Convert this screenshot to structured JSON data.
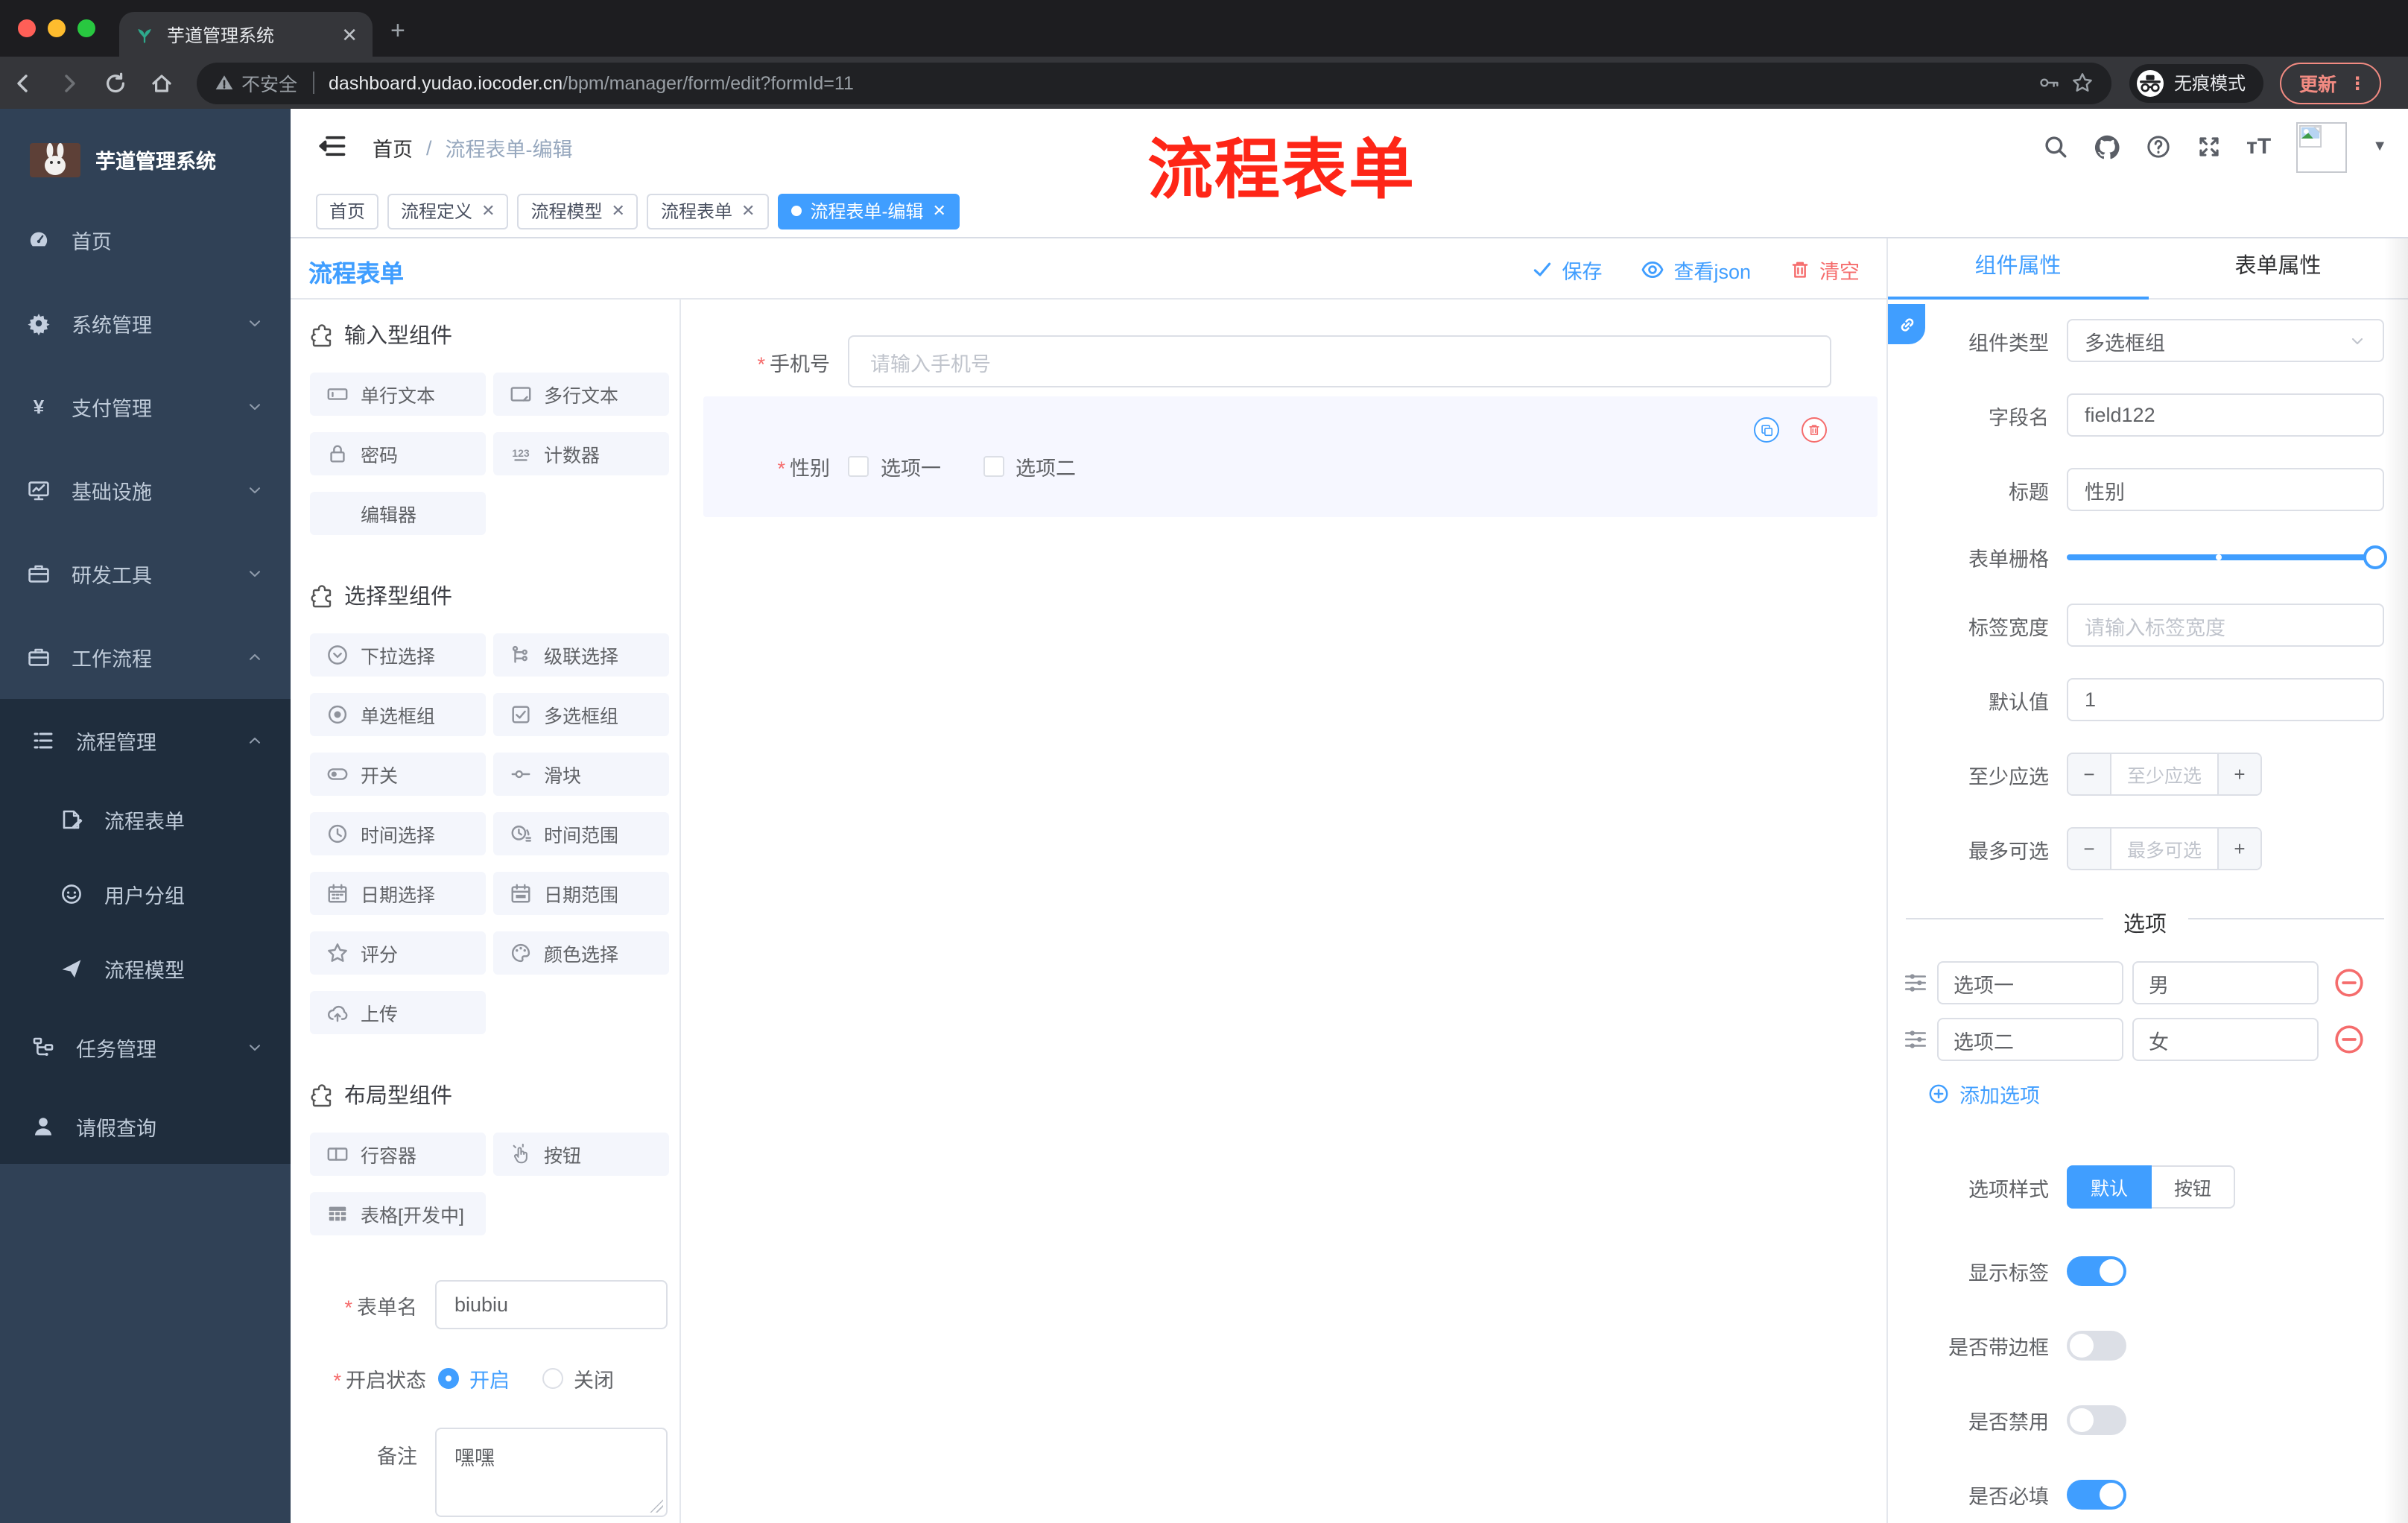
{
  "browser": {
    "tab_title": "芋道管理系统",
    "url_warning": "不安全",
    "url_domain": "dashboard.yudao.iocoder.cn",
    "url_path": "/bpm/manager/form/edit?formId=11",
    "incognito_label": "无痕模式",
    "update_label": "更新"
  },
  "header": {
    "breadcrumb_home": "首页",
    "breadcrumb_current": "流程表单-编辑",
    "annotation": "流程表单"
  },
  "view_tabs": [
    {
      "label": "首页",
      "closable": false,
      "active": false
    },
    {
      "label": "流程定义",
      "closable": true,
      "active": false
    },
    {
      "label": "流程模型",
      "closable": true,
      "active": false
    },
    {
      "label": "流程表单",
      "closable": true,
      "active": false
    },
    {
      "label": "流程表单-编辑",
      "closable": true,
      "active": true
    }
  ],
  "sidebar": {
    "logo_title": "芋道管理系统",
    "items": [
      {
        "label": "首页",
        "icon": "dashboard",
        "chevron": ""
      },
      {
        "label": "系统管理",
        "icon": "gear",
        "chevron": "down"
      },
      {
        "label": "支付管理",
        "icon": "yen",
        "chevron": "down"
      },
      {
        "label": "基础设施",
        "icon": "monitor",
        "chevron": "down"
      },
      {
        "label": "研发工具",
        "icon": "briefcase",
        "chevron": "down"
      },
      {
        "label": "工作流程",
        "icon": "briefcase",
        "chevron": "up"
      }
    ],
    "submenu": [
      {
        "label": "流程管理",
        "icon": "listtree",
        "level": 1,
        "chevron": "up"
      },
      {
        "label": "流程表单",
        "icon": "docedit",
        "level": 2,
        "chevron": ""
      },
      {
        "label": "用户分组",
        "icon": "face",
        "level": 2,
        "chevron": ""
      },
      {
        "label": "流程模型",
        "icon": "send",
        "level": 2,
        "chevron": ""
      },
      {
        "label": "任务管理",
        "icon": "tree",
        "level": 1,
        "chevron": "down"
      },
      {
        "label": "请假查询",
        "icon": "user",
        "level": 1,
        "chevron": ""
      }
    ]
  },
  "designer": {
    "title": "流程表单",
    "actions": {
      "save": "保存",
      "view_json": "查看json",
      "clear": "清空"
    },
    "palette": {
      "sections": [
        {
          "title": "输入型组件",
          "items": [
            {
              "icon": "inputbox",
              "label": "单行文本"
            },
            {
              "icon": "textareabox",
              "label": "多行文本"
            },
            {
              "icon": "lock",
              "label": "密码"
            },
            {
              "icon": "counter",
              "label": "计数器"
            },
            {
              "icon": "",
              "label": "编辑器"
            }
          ]
        },
        {
          "title": "选择型组件",
          "items": [
            {
              "icon": "selectcircle",
              "label": "下拉选择"
            },
            {
              "icon": "cascader",
              "label": "级联选择"
            },
            {
              "icon": "radioico",
              "label": "单选框组"
            },
            {
              "icon": "checkboxico",
              "label": "多选框组"
            },
            {
              "icon": "switchico",
              "label": "开关"
            },
            {
              "icon": "sliderico",
              "label": "滑块"
            },
            {
              "icon": "clock",
              "label": "时间选择"
            },
            {
              "icon": "clockrange",
              "label": "时间范围"
            },
            {
              "icon": "calendar",
              "label": "日期选择"
            },
            {
              "icon": "calendarrange",
              "label": "日期范围"
            },
            {
              "icon": "starico",
              "label": "评分"
            },
            {
              "icon": "paletteico",
              "label": "颜色选择"
            },
            {
              "icon": "upload",
              "label": "上传"
            }
          ]
        },
        {
          "title": "布局型组件",
          "items": [
            {
              "icon": "rowbox",
              "label": "行容器"
            },
            {
              "icon": "handbtn",
              "label": "按钮"
            },
            {
              "icon": "tablegrid",
              "label": "表格[开发中]"
            }
          ]
        }
      ]
    },
    "form": {
      "name_label": "表单名",
      "name_value": "biubiu",
      "status_label": "开启状态",
      "status_on": "开启",
      "status_off": "关闭",
      "remark_label": "备注",
      "remark_value": "嘿嘿"
    },
    "canvas": {
      "phone_label": "手机号",
      "phone_placeholder": "请输入手机号",
      "gender_label": "性别",
      "gender_options": [
        "选项一",
        "选项二"
      ]
    }
  },
  "panel": {
    "tab_component": "组件属性",
    "tab_form": "表单属性",
    "type_label": "组件类型",
    "type_value": "多选框组",
    "field_label": "字段名",
    "field_value": "field122",
    "title_label": "标题",
    "title_value": "性别",
    "grid_label": "表单栅格",
    "labelwidth_label": "标签宽度",
    "labelwidth_placeholder": "请输入标签宽度",
    "default_label": "默认值",
    "default_value": "1",
    "min_label": "至少应选",
    "min_placeholder": "至少应选",
    "max_label": "最多可选",
    "max_placeholder": "最多可选",
    "options_divider": "选项",
    "options": [
      {
        "label": "选项一",
        "value": "男"
      },
      {
        "label": "选项二",
        "value": "女"
      }
    ],
    "add_option": "添加选项",
    "style_label": "选项样式",
    "style_options": [
      "默认",
      "按钮"
    ],
    "style_selected": "默认",
    "switches": [
      {
        "label": "显示标签",
        "on": true
      },
      {
        "label": "是否带边框",
        "on": false
      },
      {
        "label": "是否禁用",
        "on": false
      },
      {
        "label": "是否必填",
        "on": true
      }
    ]
  },
  "colors": {
    "accent": "#409eff",
    "danger": "#f56c6c",
    "annotation_red": "#fe2617",
    "sidebar_bg": "#304156",
    "submenu_bg": "#1f2d3d"
  }
}
